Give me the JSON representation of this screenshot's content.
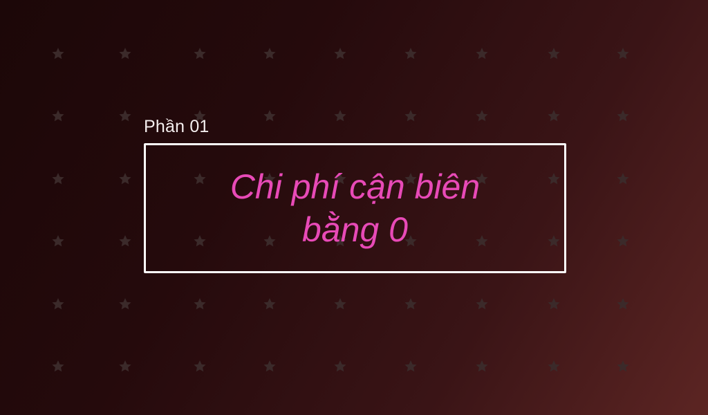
{
  "slide": {
    "section_label": "Phần 01",
    "title_lines": [
      "Chi phí cận biên",
      "bằng 0"
    ]
  },
  "colors": {
    "background_start": "#1c0708",
    "background_end": "#5c2523",
    "title": "#e84ab7",
    "label": "#f3eded",
    "frame": "#ffffff",
    "pattern_star": "#3b2a2a"
  },
  "decoration": {
    "pattern_icon": "star-icon"
  }
}
